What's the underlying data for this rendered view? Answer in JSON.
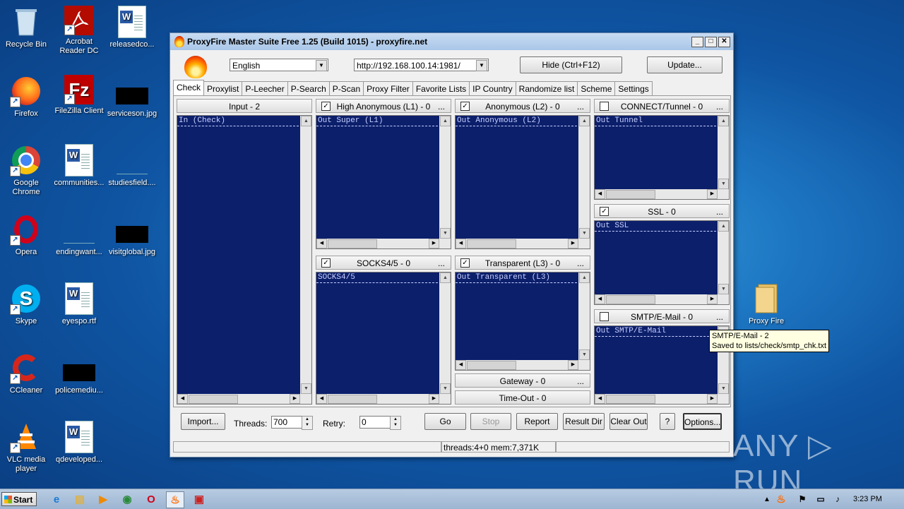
{
  "desktop": {
    "icons": [
      {
        "label": "Recycle Bin"
      },
      {
        "label": "Acrobat Reader DC"
      },
      {
        "label": "releasedco..."
      },
      {
        "label": "Firefox"
      },
      {
        "label": "FileZilla Client"
      },
      {
        "label": "serviceson.jpg"
      },
      {
        "label": "Google Chrome"
      },
      {
        "label": "communities..."
      },
      {
        "label": "studiesfield...."
      },
      {
        "label": "Opera"
      },
      {
        "label": "endingwant..."
      },
      {
        "label": "visitglobal.jpg"
      },
      {
        "label": "Skype"
      },
      {
        "label": "eyespo.rtf"
      },
      {
        "label": "CCleaner"
      },
      {
        "label": "policemediu..."
      },
      {
        "label": "VLC media player"
      },
      {
        "label": "qdeveloped..."
      },
      {
        "label": "Proxy Fire"
      }
    ]
  },
  "window": {
    "title": "ProxyFire Master Suite Free 1.25 (Build 1015)  - proxyfire.net",
    "controls": {
      "minimize": "_",
      "maximize": "□",
      "close": "✕"
    }
  },
  "toolbar": {
    "language": "English",
    "url": "http://192.168.100.14:1981/",
    "hide_button": "Hide (Ctrl+F12)",
    "update_button": "Update..."
  },
  "tabs": [
    "Check",
    "Proxylist",
    "P-Leecher",
    "P-Search",
    "P-Scan",
    "Proxy Filter",
    "Favorite Lists",
    "IP Country",
    "Randomize list",
    "Scheme",
    "Settings"
  ],
  "panels": {
    "input": {
      "header": "Input - 2",
      "content": "In (Check)"
    },
    "high_anon": {
      "header": "High Anonymous (L1) - 0",
      "content": "Out Super (L1)",
      "checked": true
    },
    "anonymous": {
      "header": "Anonymous (L2) - 0",
      "content": "Out Anonymous (L2)",
      "checked": true
    },
    "connect": {
      "header": "CONNECT/Tunnel - 0",
      "content": "Out Tunnel",
      "checked": false
    },
    "ssl": {
      "header": "SSL - 0",
      "content": "Out SSL",
      "checked": true
    },
    "socks": {
      "header": "SOCKS4/5 - 0",
      "content": "SOCKS4/5",
      "checked": true
    },
    "transparent": {
      "header": "Transparent (L3) - 0",
      "content": "Out Transparent (L3)",
      "checked": true
    },
    "smtp": {
      "header": "SMTP/E-Mail - 0",
      "content": "Out SMTP/E-Mail",
      "checked": false
    },
    "gateway": {
      "header": "Gateway - 0"
    },
    "timeout": {
      "header": "Time-Out - 0"
    },
    "more": "..."
  },
  "bottom": {
    "import": "Import...",
    "threads_label": "Threads:",
    "threads_value": "700",
    "retry_label": "Retry:",
    "retry_value": "0",
    "go": "Go",
    "stop": "Stop",
    "report": "Report",
    "result_dir": "Result Dir",
    "clear_out": "Clear Out",
    "help": "?",
    "options": "Options..."
  },
  "status": {
    "text": "threads:4+0 mem:7,371K"
  },
  "tooltip": {
    "line1": "SMTP/E-Mail - 2",
    "line2": "Saved to lists/check/smtp_chk.txt"
  },
  "taskbar": {
    "start": "Start",
    "time": "3:23 PM"
  },
  "watermark": "ANY ▷ RUN",
  "colors": {
    "list_bg": "#0c1f6b",
    "list_text": "#c8d0ff",
    "title_bar": "#b6d0ee"
  }
}
